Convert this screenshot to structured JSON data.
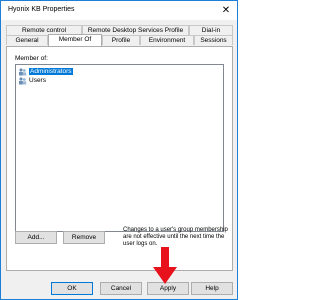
{
  "window": {
    "title": "Hyonix KB Properties",
    "close_glyph": "✕"
  },
  "tabs": {
    "row1": [
      "Remote control",
      "Remote Desktop Services Profile",
      "Dial-in"
    ],
    "row2": [
      "General",
      "Member Of",
      "Profile",
      "Environment",
      "Sessions"
    ],
    "active": "Member Of"
  },
  "panel": {
    "member_of_label": "Member of:",
    "members": [
      {
        "name": "Administrators",
        "selected": true,
        "icon": "group-icon"
      },
      {
        "name": "Users",
        "selected": false,
        "icon": "group-icon"
      }
    ],
    "add_button": "Add...",
    "remove_button": "Remove",
    "note": "Changes to a user's group membership are not effective until the next time the user logs on."
  },
  "footer": {
    "ok": "OK",
    "cancel": "Cancel",
    "apply": "Apply",
    "help": "Help"
  },
  "annotation": {
    "icon": "red-arrow-down-icon",
    "color": "#e8121d"
  },
  "colors": {
    "accent": "#0078d7",
    "window_border": "#1e7fd6"
  }
}
